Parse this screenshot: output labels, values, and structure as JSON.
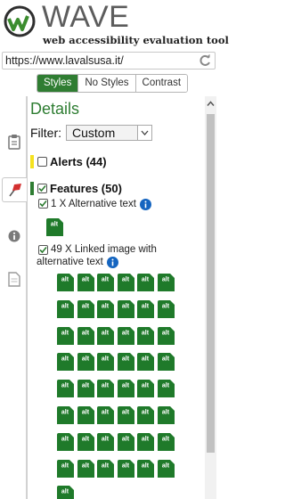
{
  "app": {
    "name": "WAVE",
    "subtitle": "web accessibility evaluation tool"
  },
  "url": {
    "value": "https://www.lavalsusa.it/"
  },
  "view_tabs": [
    {
      "label": "Styles",
      "active": true
    },
    {
      "label": "No Styles",
      "active": false
    },
    {
      "label": "Contrast",
      "active": false
    }
  ],
  "sidebar": {
    "items": [
      {
        "name": "summary",
        "icon": "clipboard-icon"
      },
      {
        "name": "details",
        "icon": "flag-icon",
        "active": true
      },
      {
        "name": "reference",
        "icon": "info-icon"
      },
      {
        "name": "structure",
        "icon": "document-icon"
      }
    ]
  },
  "panel": {
    "title": "Details",
    "filter_label": "Filter:",
    "filter_value": "Custom",
    "categories": {
      "alerts": {
        "label": "Alerts (44)",
        "color": "#f5e21f",
        "checked": false
      },
      "features": {
        "label": "Features (50)",
        "color": "#2e7d32",
        "checked": true
      }
    },
    "items": {
      "alt_text": {
        "label": "1 X Alternative text",
        "count": 1,
        "checked": true
      },
      "linked_image": {
        "label_line1": "49 X Linked image with",
        "label_line2": "alternative text",
        "count": 49,
        "checked": true
      }
    },
    "alt_icon_text": "alt"
  },
  "colors": {
    "accent_green": "#2e7d32",
    "info_blue": "#1565c0",
    "alert_yellow": "#f5e21f"
  }
}
